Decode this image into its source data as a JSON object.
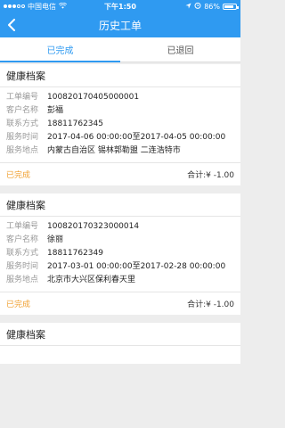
{
  "status_bar": {
    "carrier": "中国电信",
    "time": "下午1:50",
    "battery": "86%",
    "battery_level": 0.86
  },
  "nav": {
    "title": "历史工单"
  },
  "tabs": [
    {
      "label": "已完成",
      "active": true
    },
    {
      "label": "已退回",
      "active": false
    }
  ],
  "labels": {
    "order_no": "工单编号",
    "customer": "客户名称",
    "contact": "联系方式",
    "service_time": "服务时间",
    "location": "服务地点",
    "total_prefix": "合计:"
  },
  "orders": [
    {
      "category": "健康档案",
      "order_no": "100820170405000001",
      "customer": "彭福",
      "contact": "18811762345",
      "service_time": "2017-04-06 00:00:00至2017-04-05 00:00:00",
      "location": "内蒙古自治区 锡林郭勒盟 二连浩特市",
      "status": "已完成",
      "total": "¥ -1.00"
    },
    {
      "category": "健康档案",
      "order_no": "100820170323000014",
      "customer": "徐丽",
      "contact": "18811762349",
      "service_time": "2017-03-01 00:00:00至2017-02-28 00:00:00",
      "location": "北京市大兴区保利春天里",
      "status": "已完成",
      "total": "¥ -1.00"
    },
    {
      "category": "健康档案"
    }
  ],
  "colors": {
    "primary": "#2f9af1",
    "status_done": "#f0a030",
    "background": "#ededed"
  }
}
